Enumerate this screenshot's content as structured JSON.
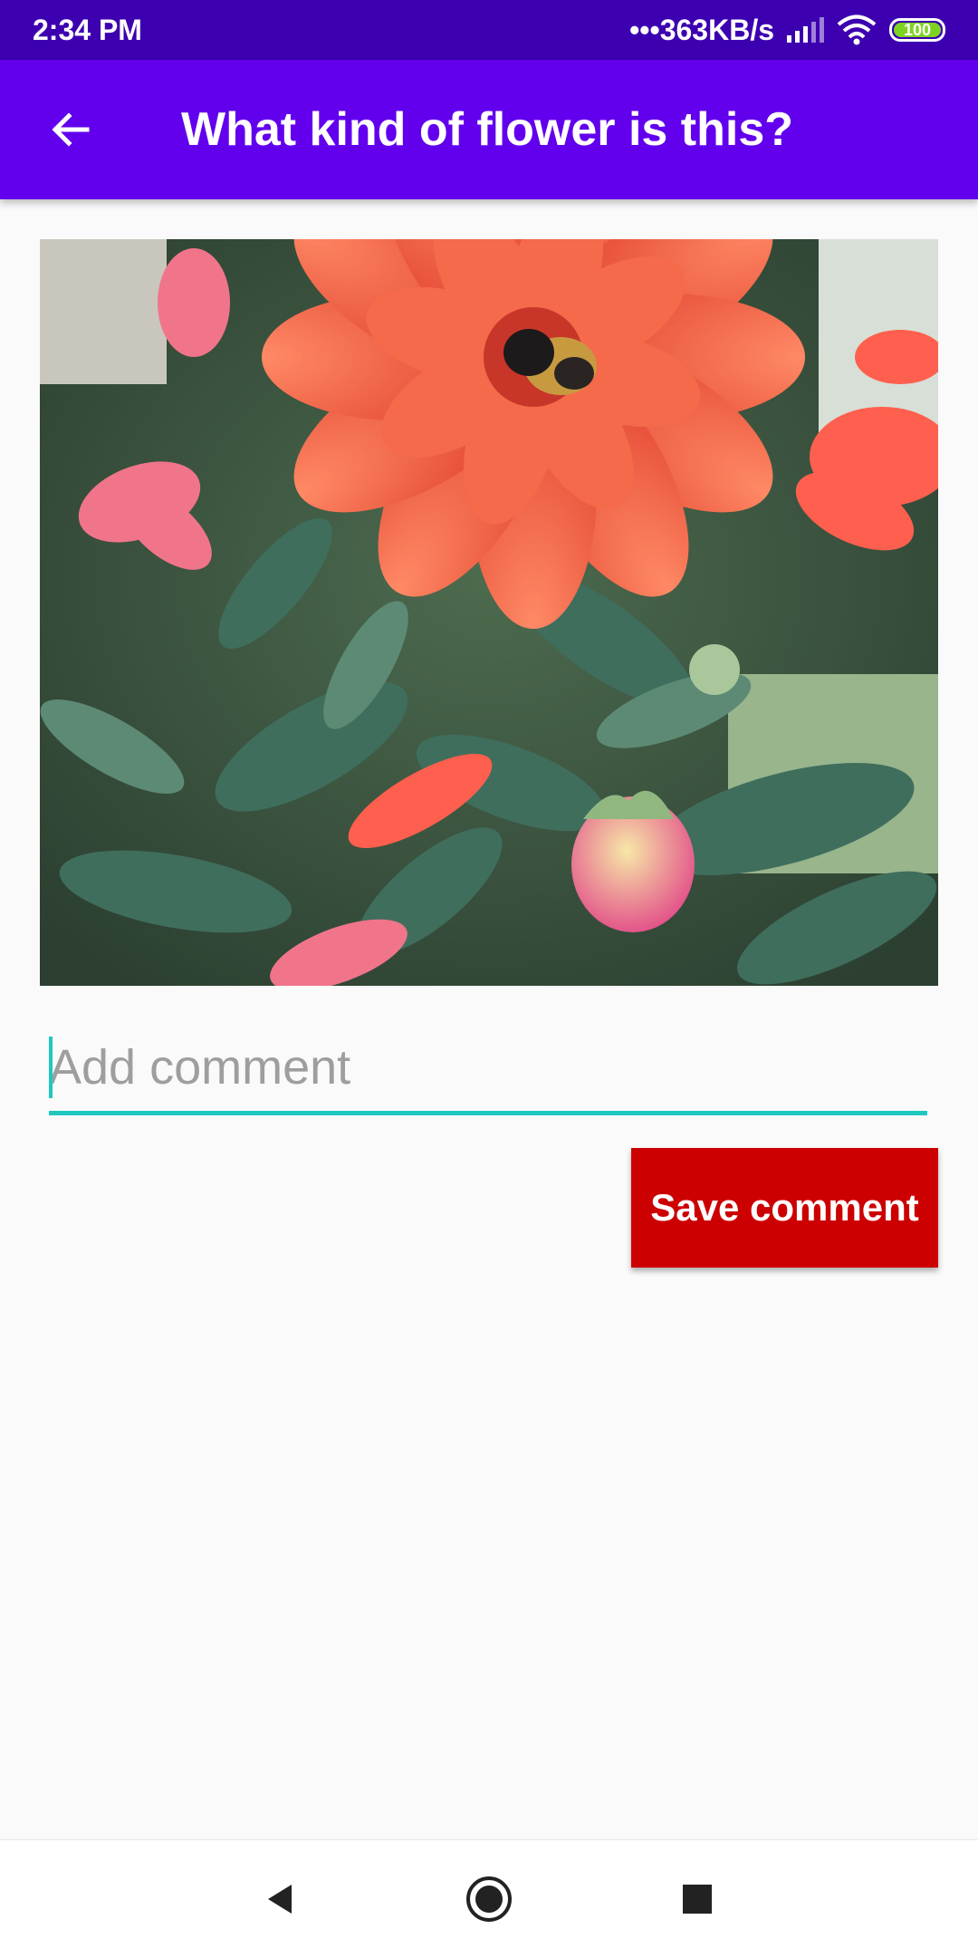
{
  "status_bar": {
    "time": "2:34 PM",
    "network_speed": "•••363KB/s",
    "battery": "100",
    "icons": [
      "signal-icon",
      "wifi-icon",
      "battery-icon"
    ]
  },
  "app_bar": {
    "title": "What kind of flower is this?",
    "back_icon": "arrow-left-icon",
    "color": "#6200ee"
  },
  "post": {
    "image": "flower-photo"
  },
  "comment": {
    "placeholder": "Add comment",
    "value": "",
    "accent": "#1ec8c0"
  },
  "save_button": {
    "label": "Save comment",
    "color": "#cc0000"
  },
  "nav_bar": {
    "icons": [
      "nav-back-icon",
      "nav-home-icon",
      "nav-recents-icon"
    ]
  }
}
